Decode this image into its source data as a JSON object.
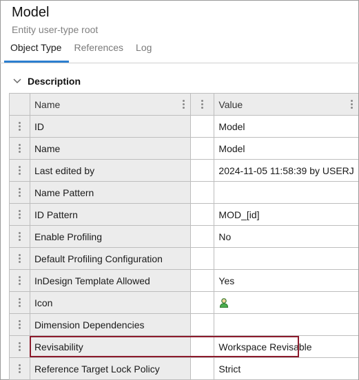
{
  "header": {
    "title": "Model",
    "subtitle": "Entity user-type root"
  },
  "tabs": [
    {
      "label": "Object Type",
      "active": true
    },
    {
      "label": "References",
      "active": false
    },
    {
      "label": "Log",
      "active": false
    }
  ],
  "section": {
    "title": "Description",
    "icon": "chevron-down-icon"
  },
  "table": {
    "columns": {
      "name": "Name",
      "value": "Value"
    },
    "rows": [
      {
        "name": "ID",
        "value": "Model"
      },
      {
        "name": "Name",
        "value": "Model"
      },
      {
        "name": "Last edited by",
        "value": "2024-11-05 11:58:39 by USERJ"
      },
      {
        "name": "Name Pattern",
        "value": ""
      },
      {
        "name": "ID Pattern",
        "value": "MOD_[id]"
      },
      {
        "name": "Enable Profiling",
        "value": "No"
      },
      {
        "name": "Default Profiling Configuration",
        "value": ""
      },
      {
        "name": "InDesign Template Allowed",
        "value": "Yes"
      },
      {
        "name": "Icon",
        "value": "",
        "icon": "user-icon"
      },
      {
        "name": "Dimension Dependencies",
        "value": ""
      },
      {
        "name": "Revisability",
        "value": "Workspace Revisable",
        "highlighted": true
      },
      {
        "name": "Reference Target Lock Policy",
        "value": "Strict"
      }
    ]
  },
  "colors": {
    "tab_underline": "#2c7fd0",
    "highlight_border": "#8b1a2b",
    "header_bg": "#ececec"
  }
}
